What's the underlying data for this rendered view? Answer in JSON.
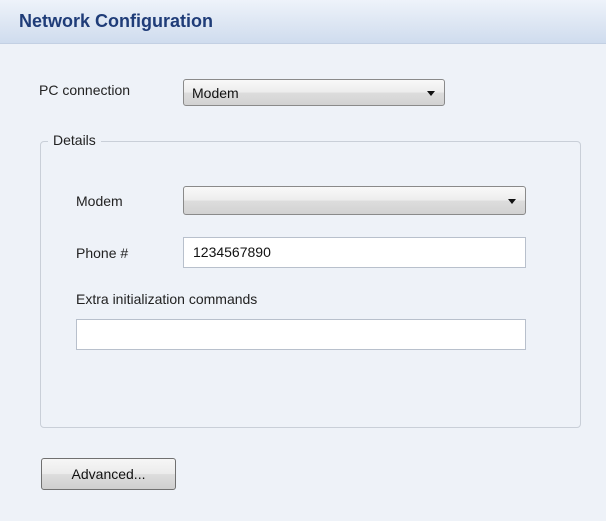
{
  "panel": {
    "title": "Network Configuration"
  },
  "pc_connection": {
    "label": "PC connection",
    "selected": "Modem"
  },
  "details": {
    "legend": "Details",
    "modem": {
      "label": "Modem",
      "selected": ""
    },
    "phone": {
      "label": "Phone #",
      "value": "1234567890"
    },
    "extra_init": {
      "label": "Extra initialization commands",
      "value": ""
    }
  },
  "buttons": {
    "advanced_label": "Advanced..."
  },
  "icons": {
    "dropdown": "chevron-down-icon"
  },
  "colors": {
    "header_title": "#1f3c78",
    "background": "#eef2f8"
  }
}
